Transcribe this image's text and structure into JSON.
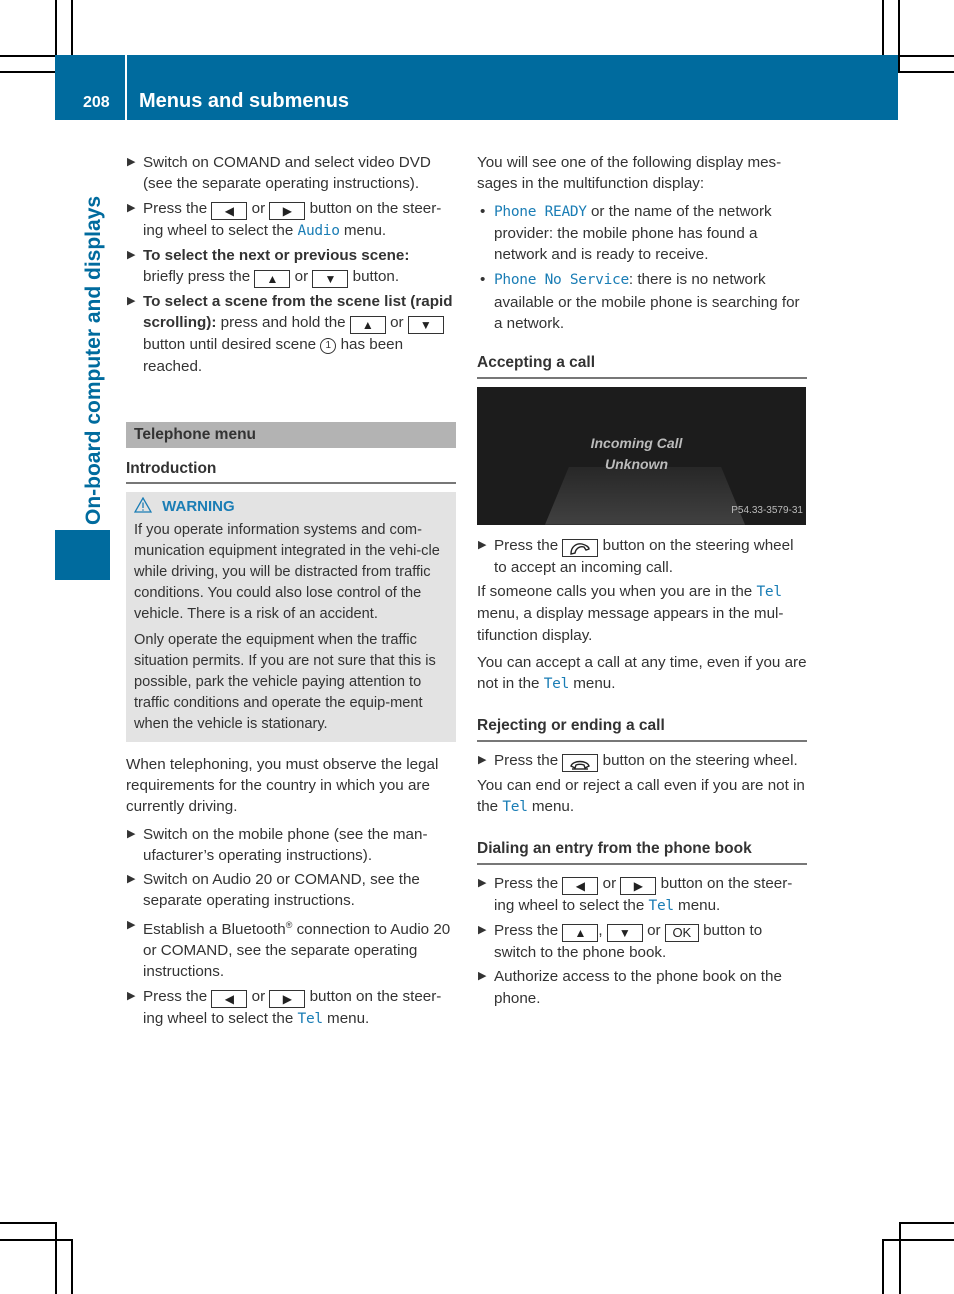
{
  "header": {
    "page_number": "208",
    "section_title": "Menus and submenus",
    "brand_color": "#006b9e"
  },
  "side_tab": {
    "chapter_title": "On-board computer and displays"
  },
  "left_column": {
    "steps_top": [
      {
        "text": "Switch on COMAND and select video DVD (see the separate operating instructions)."
      },
      {
        "pre": "Press the",
        "mid": "or",
        "post": "button on the steer-ing wheel to select the",
        "menu": "Audio",
        "end": "menu."
      },
      {
        "bold": "To select the next or previous scene:",
        "pre": "briefly press the",
        "mid": "or",
        "post": "button."
      },
      {
        "bold": "To select a scene from the scene list (rapid scrolling):",
        "pre": "press and hold the",
        "mid": "or",
        "post": "button until desired scene",
        "callout": "1",
        "end": "has been reached."
      }
    ],
    "section_bar": "Telephone menu",
    "intro_heading": "Introduction",
    "warning": {
      "icon": "warning-triangle-icon",
      "title": "WARNING",
      "paragraphs": [
        "If you operate information systems and com-munication equipment integrated in the vehi-cle while driving, you will be distracted from traffic conditions. You could also lose control of the vehicle. There is a risk of an accident.",
        "Only operate the equipment when the traffic situation permits. If you are not sure that this is possible, park the vehicle paying attention to traffic conditions and operate the equip-ment when the vehicle is stationary."
      ]
    },
    "body_paragraph": "When telephoning, you must observe the legal requirements for the country in which you are currently driving.",
    "steps_bottom": [
      {
        "text": "Switch on the mobile phone (see the man-ufacturer’s operating instructions)."
      },
      {
        "text": "Switch on Audio 20 or COMAND, see the separate operating instructions."
      },
      {
        "pre": "Establish a Bluetooth",
        "sup": "®",
        "post": "connection to Audio 20 or COMAND, see the separate operating instructions."
      },
      {
        "pre": "Press the",
        "mid": "or",
        "post": "button on the steer-ing wheel to select the",
        "menu": "Tel",
        "end": "menu."
      }
    ]
  },
  "right_column": {
    "intro": "You will see one of the following display mes-sages in the multifunction display:",
    "bullets": [
      {
        "code": "Phone READY",
        "text": "or the name of the network provider: the mobile phone has found a network and is ready to receive."
      },
      {
        "code": "Phone No Service",
        "text": ": there is no network available or the mobile phone is searching for a network."
      }
    ],
    "accepting": {
      "heading": "Accepting a call",
      "figure": {
        "line1": "Incoming Call",
        "line2": "Unknown",
        "code": "P54.33-3579-31"
      },
      "step": {
        "pre": "Press the",
        "post": "button on the steering wheel to accept an incoming call.",
        "key_icon": "phone-accept-icon"
      },
      "para1": {
        "pre": "If someone calls you when you are in the",
        "menu": "Tel",
        "post": "menu, a display message appears in the mul-tifunction display."
      },
      "para2": {
        "pre": "You can accept a call at any time, even if you are not in the",
        "menu": "Tel",
        "post": "menu."
      }
    },
    "rejecting": {
      "heading": "Rejecting or ending a call",
      "step": {
        "pre": "Press the",
        "post": "button on the steering wheel.",
        "key_icon": "phone-end-icon"
      },
      "para": {
        "pre": "You can end or reject a call even if you are not in the",
        "menu": "Tel",
        "post": "menu."
      }
    },
    "dialing": {
      "heading": "Dialing an entry from the phone book",
      "steps": [
        {
          "pre": "Press the",
          "mid": "or",
          "post": "button on the steer-ing wheel to select the",
          "menu": "Tel",
          "end": "menu."
        },
        {
          "pre": "Press the",
          "comma": ",",
          "mid": "or",
          "ok": "OK",
          "post": "button to switch to the phone book."
        },
        {
          "text": "Authorize access to the phone book on the phone."
        }
      ]
    }
  }
}
